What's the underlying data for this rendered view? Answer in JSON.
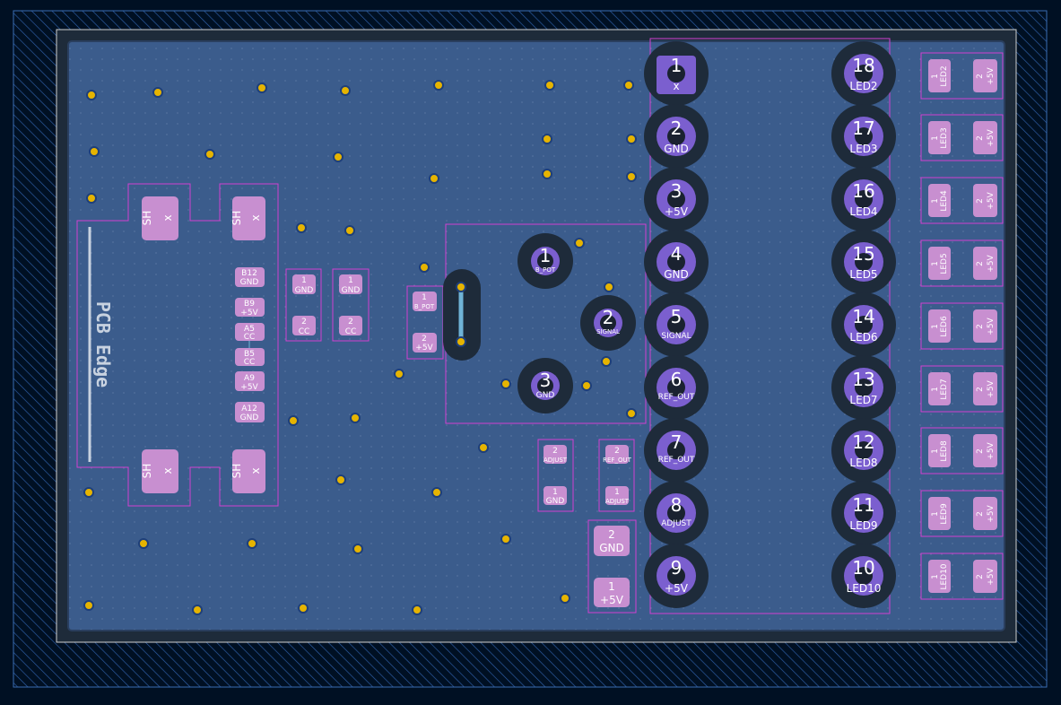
{
  "colors": {
    "background": "#001023",
    "copper_fill": "#3b5c8c",
    "copper_edge": "#2a3f5f",
    "pad": "#c88fd0",
    "pad_dark": "#7b5fcf",
    "courtyard": "#d040d0",
    "via_ring": "#e6b400",
    "edge_cuts": "#d0d0d0",
    "hatch": "#3a6bb0"
  },
  "board": {
    "edge_label": "PCB Edge"
  },
  "usb_connector": {
    "shield_label_num": "SH",
    "shield_label_net": "x",
    "pins": [
      {
        "num": "B12",
        "net": "GND"
      },
      {
        "num": "B9",
        "net": "+5V"
      },
      {
        "num": "A5",
        "net": "CC"
      },
      {
        "num": "B5",
        "net": "CC"
      },
      {
        "num": "A9",
        "net": "+5V"
      },
      {
        "num": "A12",
        "net": "GND"
      }
    ]
  },
  "resistors": [
    {
      "pin1": "1",
      "net1": "GND",
      "pin2": "2",
      "net2": "CC"
    },
    {
      "pin1": "1",
      "net1": "GND",
      "pin2": "2",
      "net2": "CC"
    },
    {
      "pin1": "1",
      "net1": "B_POT",
      "pin2": "2",
      "net2": "+5V"
    }
  ],
  "pot": {
    "pins": [
      {
        "num": "1",
        "net": "B_POT"
      },
      {
        "num": "2",
        "net": "SIGNAL"
      },
      {
        "num": "3",
        "net": "GND"
      }
    ]
  },
  "small_parts": [
    {
      "pin_top": "2",
      "net_top": "ADJUST",
      "pin_bot": "1",
      "net_bot": "GND"
    },
    {
      "pin_top": "2",
      "net_top": "REF_OUT",
      "pin_bot": "1",
      "net_bot": "ADJUST"
    }
  ],
  "cap": {
    "pin_top": "2",
    "net_top": "GND",
    "pin_bot": "1",
    "net_bot": "+5V"
  },
  "ic_left": [
    {
      "num": "1",
      "net": "x"
    },
    {
      "num": "2",
      "net": "GND"
    },
    {
      "num": "3",
      "net": "+5V"
    },
    {
      "num": "4",
      "net": "GND"
    },
    {
      "num": "5",
      "net": "SIGNAL"
    },
    {
      "num": "6",
      "net": "REF_OUT"
    },
    {
      "num": "7",
      "net": "REF_OUT"
    },
    {
      "num": "8",
      "net": "ADJUST"
    },
    {
      "num": "9",
      "net": "+5V"
    }
  ],
  "ic_right": [
    {
      "num": "18",
      "net": "LED2"
    },
    {
      "num": "17",
      "net": "LED3"
    },
    {
      "num": "16",
      "net": "LED4"
    },
    {
      "num": "15",
      "net": "LED5"
    },
    {
      "num": "14",
      "net": "LED6"
    },
    {
      "num": "13",
      "net": "LED7"
    },
    {
      "num": "12",
      "net": "LED8"
    },
    {
      "num": "11",
      "net": "LED9"
    },
    {
      "num": "10",
      "net": "LED10"
    }
  ],
  "leds": [
    {
      "pin1": "1",
      "net1": "LED2",
      "pin2": "2",
      "net2": "+5V"
    },
    {
      "pin1": "1",
      "net1": "LED3",
      "pin2": "2",
      "net2": "+5V"
    },
    {
      "pin1": "1",
      "net1": "LED4",
      "pin2": "2",
      "net2": "+5V"
    },
    {
      "pin1": "1",
      "net1": "LED5",
      "pin2": "2",
      "net2": "+5V"
    },
    {
      "pin1": "1",
      "net1": "LED6",
      "pin2": "2",
      "net2": "+5V"
    },
    {
      "pin1": "1",
      "net1": "LED7",
      "pin2": "2",
      "net2": "+5V"
    },
    {
      "pin1": "1",
      "net1": "LED8",
      "pin2": "2",
      "net2": "+5V"
    },
    {
      "pin1": "1",
      "net1": "LED9",
      "pin2": "2",
      "net2": "+5V"
    },
    {
      "pin1": "1",
      "net1": "LED10",
      "pin2": "2",
      "net2": "+5V"
    }
  ]
}
